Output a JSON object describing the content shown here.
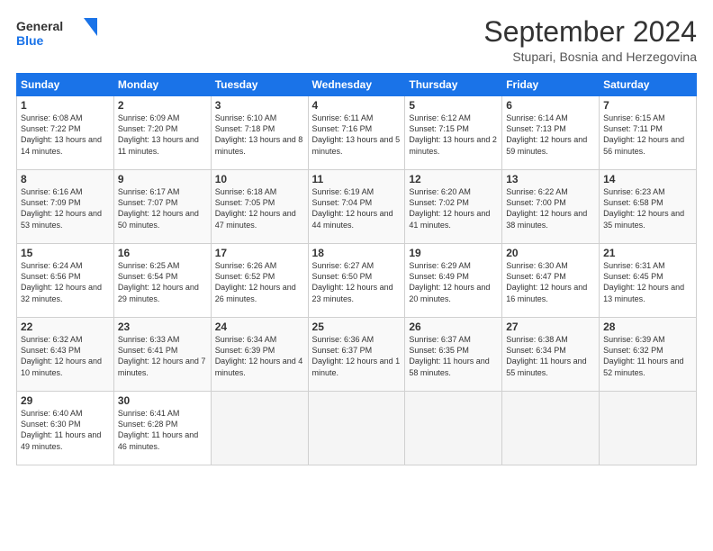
{
  "logo": {
    "line1": "General",
    "line2": "Blue"
  },
  "title": "September 2024",
  "location": "Stupari, Bosnia and Herzegovina",
  "weekdays": [
    "Sunday",
    "Monday",
    "Tuesday",
    "Wednesday",
    "Thursday",
    "Friday",
    "Saturday"
  ],
  "weeks": [
    [
      {
        "day": 1,
        "sunrise": "6:08 AM",
        "sunset": "7:22 PM",
        "daylight": "13 hours and 14 minutes."
      },
      {
        "day": 2,
        "sunrise": "6:09 AM",
        "sunset": "7:20 PM",
        "daylight": "13 hours and 11 minutes."
      },
      {
        "day": 3,
        "sunrise": "6:10 AM",
        "sunset": "7:18 PM",
        "daylight": "13 hours and 8 minutes."
      },
      {
        "day": 4,
        "sunrise": "6:11 AM",
        "sunset": "7:16 PM",
        "daylight": "13 hours and 5 minutes."
      },
      {
        "day": 5,
        "sunrise": "6:12 AM",
        "sunset": "7:15 PM",
        "daylight": "13 hours and 2 minutes."
      },
      {
        "day": 6,
        "sunrise": "6:14 AM",
        "sunset": "7:13 PM",
        "daylight": "12 hours and 59 minutes."
      },
      {
        "day": 7,
        "sunrise": "6:15 AM",
        "sunset": "7:11 PM",
        "daylight": "12 hours and 56 minutes."
      }
    ],
    [
      {
        "day": 8,
        "sunrise": "6:16 AM",
        "sunset": "7:09 PM",
        "daylight": "12 hours and 53 minutes."
      },
      {
        "day": 9,
        "sunrise": "6:17 AM",
        "sunset": "7:07 PM",
        "daylight": "12 hours and 50 minutes."
      },
      {
        "day": 10,
        "sunrise": "6:18 AM",
        "sunset": "7:05 PM",
        "daylight": "12 hours and 47 minutes."
      },
      {
        "day": 11,
        "sunrise": "6:19 AM",
        "sunset": "7:04 PM",
        "daylight": "12 hours and 44 minutes."
      },
      {
        "day": 12,
        "sunrise": "6:20 AM",
        "sunset": "7:02 PM",
        "daylight": "12 hours and 41 minutes."
      },
      {
        "day": 13,
        "sunrise": "6:22 AM",
        "sunset": "7:00 PM",
        "daylight": "12 hours and 38 minutes."
      },
      {
        "day": 14,
        "sunrise": "6:23 AM",
        "sunset": "6:58 PM",
        "daylight": "12 hours and 35 minutes."
      }
    ],
    [
      {
        "day": 15,
        "sunrise": "6:24 AM",
        "sunset": "6:56 PM",
        "daylight": "12 hours and 32 minutes."
      },
      {
        "day": 16,
        "sunrise": "6:25 AM",
        "sunset": "6:54 PM",
        "daylight": "12 hours and 29 minutes."
      },
      {
        "day": 17,
        "sunrise": "6:26 AM",
        "sunset": "6:52 PM",
        "daylight": "12 hours and 26 minutes."
      },
      {
        "day": 18,
        "sunrise": "6:27 AM",
        "sunset": "6:50 PM",
        "daylight": "12 hours and 23 minutes."
      },
      {
        "day": 19,
        "sunrise": "6:29 AM",
        "sunset": "6:49 PM",
        "daylight": "12 hours and 20 minutes."
      },
      {
        "day": 20,
        "sunrise": "6:30 AM",
        "sunset": "6:47 PM",
        "daylight": "12 hours and 16 minutes."
      },
      {
        "day": 21,
        "sunrise": "6:31 AM",
        "sunset": "6:45 PM",
        "daylight": "12 hours and 13 minutes."
      }
    ],
    [
      {
        "day": 22,
        "sunrise": "6:32 AM",
        "sunset": "6:43 PM",
        "daylight": "12 hours and 10 minutes."
      },
      {
        "day": 23,
        "sunrise": "6:33 AM",
        "sunset": "6:41 PM",
        "daylight": "12 hours and 7 minutes."
      },
      {
        "day": 24,
        "sunrise": "6:34 AM",
        "sunset": "6:39 PM",
        "daylight": "12 hours and 4 minutes."
      },
      {
        "day": 25,
        "sunrise": "6:36 AM",
        "sunset": "6:37 PM",
        "daylight": "12 hours and 1 minute."
      },
      {
        "day": 26,
        "sunrise": "6:37 AM",
        "sunset": "6:35 PM",
        "daylight": "11 hours and 58 minutes."
      },
      {
        "day": 27,
        "sunrise": "6:38 AM",
        "sunset": "6:34 PM",
        "daylight": "11 hours and 55 minutes."
      },
      {
        "day": 28,
        "sunrise": "6:39 AM",
        "sunset": "6:32 PM",
        "daylight": "11 hours and 52 minutes."
      }
    ],
    [
      {
        "day": 29,
        "sunrise": "6:40 AM",
        "sunset": "6:30 PM",
        "daylight": "11 hours and 49 minutes."
      },
      {
        "day": 30,
        "sunrise": "6:41 AM",
        "sunset": "6:28 PM",
        "daylight": "11 hours and 46 minutes."
      },
      null,
      null,
      null,
      null,
      null
    ]
  ]
}
